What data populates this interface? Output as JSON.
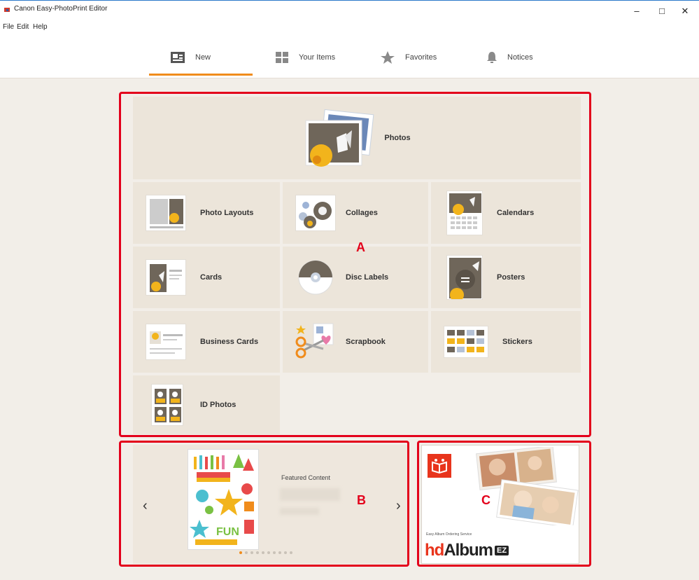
{
  "window": {
    "title": "Canon Easy-PhotoPrint Editor",
    "controls": {
      "minimize": "–",
      "maximize": "□",
      "close": "✕"
    }
  },
  "menu": [
    "File",
    "Edit",
    "Help"
  ],
  "tabs": [
    {
      "label": "New",
      "icon": "new-icon",
      "selected": true
    },
    {
      "label": "Your Items",
      "icon": "grid-icon"
    },
    {
      "label": "Favorites",
      "icon": "star-icon"
    },
    {
      "label": "Notices",
      "icon": "bell-icon"
    }
  ],
  "categories": {
    "photos": "Photos",
    "items": [
      "Photo Layouts",
      "Collages",
      "Calendars",
      "Cards",
      "Disc Labels",
      "Posters",
      "Business Cards",
      "Scrapbook",
      "Stickers",
      "ID Photos"
    ]
  },
  "featured": {
    "heading": "Featured Content",
    "prev": "‹",
    "next": "›",
    "page_count": 10,
    "current_page": 1
  },
  "album": {
    "tagline": "Easy Album Ordering Service",
    "brand_hd": "hd",
    "brand_album": "Album",
    "brand_badge": "EZ"
  },
  "annotations": {
    "a": "A",
    "b": "B",
    "c": "C"
  },
  "colors": {
    "accent": "#f08c1c",
    "highlight": "#e3001b",
    "tile": "#ece5da"
  }
}
